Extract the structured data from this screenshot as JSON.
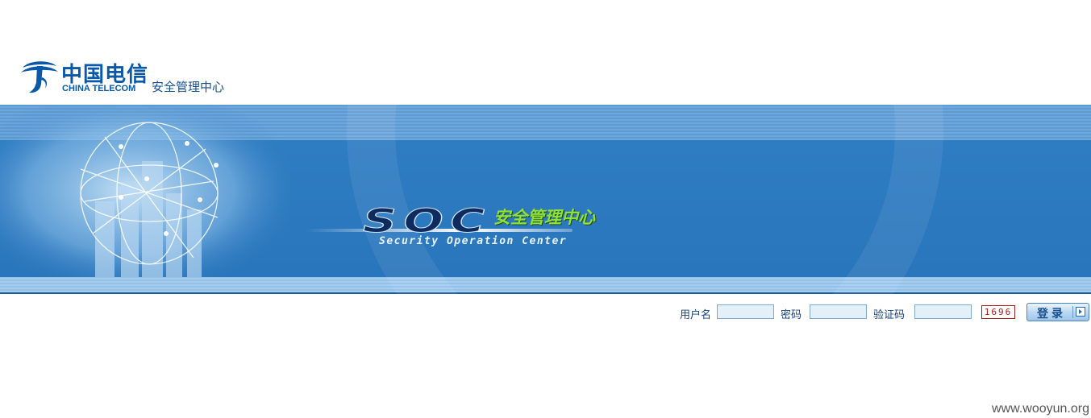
{
  "header": {
    "logo": {
      "cn_name": "中国电信",
      "en_name": "CHINA TELECOM"
    },
    "subtitle": "安全管理中心"
  },
  "banner": {
    "soc_title": "SOC",
    "soc_cn": "安全管理中心",
    "soc_en": "Security Operation Center"
  },
  "login": {
    "username_label": "用户名",
    "username_value": "",
    "password_label": "密码",
    "password_value": "",
    "captcha_label": "验证码",
    "captcha_value": "",
    "captcha_code": "1696",
    "submit_label": "登录",
    "submit_icon": "arrow-right-icon"
  },
  "watermark": "www.wooyun.org",
  "colors": {
    "brand_blue": "#0a58a8",
    "banner_blue": "#2b78bd",
    "soc_green": "#8fe03a",
    "label_text": "#18457a"
  }
}
